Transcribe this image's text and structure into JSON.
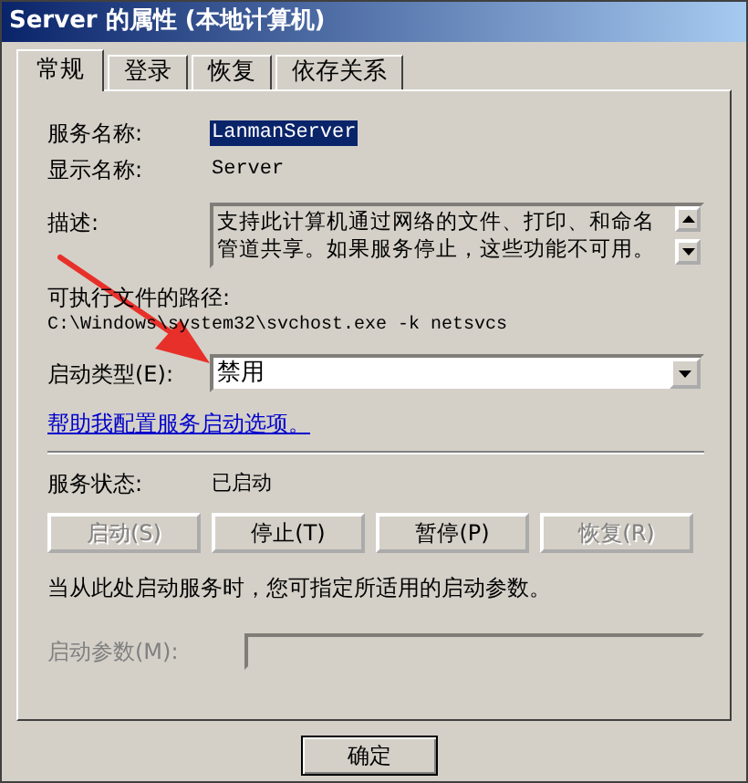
{
  "window": {
    "title": "Server 的属性 (本地计算机)"
  },
  "tabs": [
    {
      "label": "常规",
      "selected": true
    },
    {
      "label": "登录",
      "selected": false
    },
    {
      "label": "恢复",
      "selected": false
    },
    {
      "label": "依存关系",
      "selected": false
    }
  ],
  "fields": [
    {
      "label": "服务名称:",
      "value": "LanmanServer",
      "selected": true
    },
    {
      "label": "显示名称:",
      "value": "Server",
      "selected": false
    }
  ],
  "description": {
    "label": "描述:",
    "text": "支持此计算机通过网络的文件、打印、和命名管道共享。如果服务停止，这些功能不可用。"
  },
  "executable": {
    "label": "可执行文件的路径:",
    "path": "C:\\Windows\\system32\\svchost.exe -k netsvcs"
  },
  "startup_type": {
    "label": "启动类型(E):",
    "value": "禁用"
  },
  "help_link": "帮助我配置服务启动选项。",
  "service_status": {
    "label": "服务状态:",
    "value": "已启动"
  },
  "service_buttons": [
    {
      "label": "启动(S)",
      "disabled": true
    },
    {
      "label": "停止(T)",
      "disabled": false
    },
    {
      "label": "暂停(P)",
      "disabled": false
    },
    {
      "label": "恢复(R)",
      "disabled": true
    }
  ],
  "hint": "当从此处启动服务时，您可指定所适用的启动参数。",
  "start_parameters": {
    "label": "启动参数(M):",
    "disabled": true
  },
  "dialog_buttons": [
    {
      "label": "确定"
    }
  ]
}
